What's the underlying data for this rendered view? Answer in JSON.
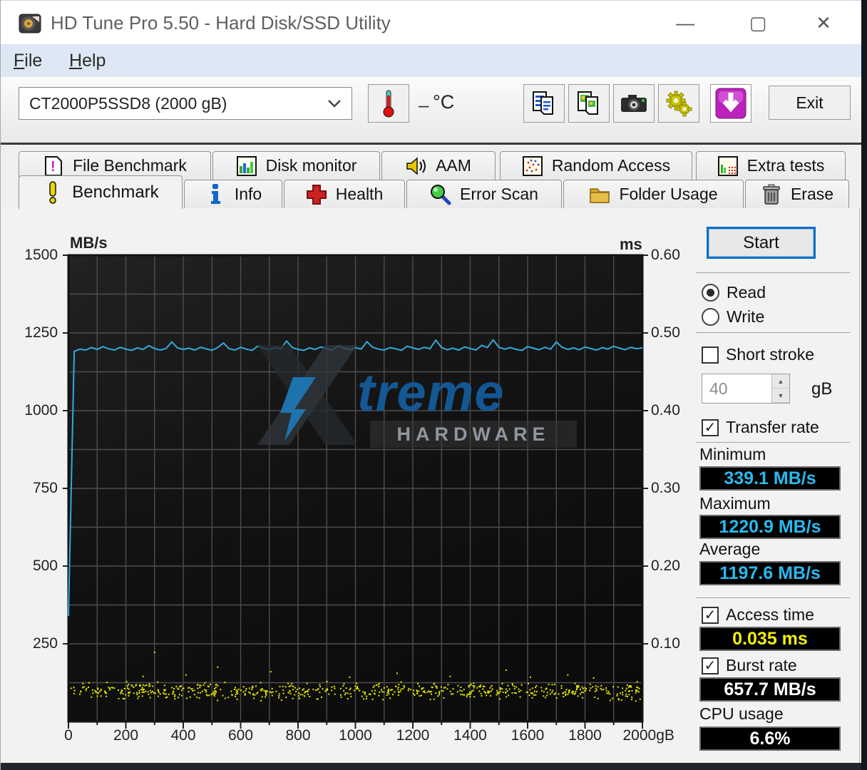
{
  "window": {
    "title": "HD Tune Pro 5.50 - Hard Disk/SSD Utility",
    "controls": {
      "minimize": "—",
      "maximize": "▢",
      "close": "✕"
    }
  },
  "menu": {
    "file": {
      "initial": "F",
      "rest": "ile"
    },
    "help": {
      "initial": "H",
      "rest": "elp"
    }
  },
  "toolbar": {
    "drive_select_value": "CT2000P5SSD8 (2000 gB)",
    "temperature_dash": "–",
    "temperature_unit": "°C",
    "exit_label": "Exit"
  },
  "tabs": {
    "row1": [
      {
        "label": "File Benchmark"
      },
      {
        "label": "Disk monitor"
      },
      {
        "label": "AAM"
      },
      {
        "label": "Random Access"
      },
      {
        "label": "Extra tests"
      }
    ],
    "row2": [
      {
        "label": "Benchmark",
        "active": true
      },
      {
        "label": "Info"
      },
      {
        "label": "Health"
      },
      {
        "label": "Error Scan"
      },
      {
        "label": "Folder Usage"
      },
      {
        "label": "Erase"
      }
    ]
  },
  "controls": {
    "start_label": "Start",
    "read_label": "Read",
    "write_label": "Write",
    "short_stroke_label": "Short stroke",
    "short_stroke_value": "40",
    "short_stroke_unit": "gB",
    "transfer_rate_label": "Transfer rate",
    "minimum_label": "Minimum",
    "minimum_value": "339.1 MB/s",
    "maximum_label": "Maximum",
    "maximum_value": "1220.9 MB/s",
    "average_label": "Average",
    "average_value": "1197.6 MB/s",
    "access_time_label": "Access time",
    "access_time_value": "0.035 ms",
    "burst_rate_label": "Burst rate",
    "burst_rate_value": "657.7 MB/s",
    "cpu_usage_label": "CPU usage",
    "cpu_usage_value": "6.6%",
    "check_glyph": "✓"
  },
  "colors": {
    "value_cyan": "#29b9ee",
    "value_yellow": "#f0ef0c",
    "value_white": "#ffffff"
  },
  "chart_data": {
    "type": "line",
    "title": "HD Tune Pro read benchmark",
    "x_axis": {
      "unit": "gB",
      "range": [
        0,
        2000
      ],
      "major_tick": 200,
      "minor_tick": 100,
      "tick_values": [
        0,
        200,
        400,
        600,
        800,
        1000,
        1200,
        1400,
        1600,
        1800,
        2000
      ],
      "tick_labels": [
        "0",
        "200",
        "400",
        "600",
        "800",
        "1000",
        "1200",
        "1400",
        "1600",
        "1800",
        "2000gB"
      ]
    },
    "left_axis": {
      "label": "MB/s",
      "range": [
        0,
        1500
      ],
      "tick_values": [
        1500,
        1250,
        1000,
        750,
        500,
        250
      ],
      "tick_labels": [
        "1500",
        "1250",
        "1000",
        "750",
        "500",
        "250"
      ]
    },
    "right_axis": {
      "label": "ms",
      "range": [
        0,
        0.6
      ],
      "tick_values": [
        0.6,
        0.5,
        0.4,
        0.3,
        0.2,
        0.1
      ],
      "tick_labels": [
        "0.60",
        "0.50",
        "0.40",
        "0.30",
        "0.20",
        "0.10"
      ]
    },
    "grid": {
      "vertical_step": 100,
      "horizontal_step": 125,
      "color": "#4e4e4e",
      "on": true
    },
    "legend": {
      "visible": false
    },
    "series": [
      {
        "name": "transfer-rate",
        "type": "line",
        "color": "#32aadc",
        "unit": "MB/s",
        "x_step": 20,
        "values": [
          339,
          1191,
          1198,
          1195,
          1203,
          1197,
          1206,
          1199,
          1195,
          1204,
          1198,
          1194,
          1202,
          1197,
          1209,
          1200,
          1195,
          1200,
          1221,
          1202,
          1197,
          1201,
          1195,
          1204,
          1199,
          1194,
          1203,
          1218,
          1199,
          1195,
          1204,
          1198,
          1194,
          1208,
          1201,
          1196,
          1203,
          1199,
          1224,
          1203,
          1197,
          1194,
          1202,
          1197,
          1205,
          1200,
          1195,
          1209,
          1201,
          1196,
          1203,
          1198,
          1222,
          1204,
          1198,
          1195,
          1203,
          1199,
          1194,
          1207,
          1202,
          1197,
          1204,
          1199,
          1227,
          1203,
          1196,
          1201,
          1195,
          1205,
          1200,
          1195,
          1210,
          1203,
          1228,
          1204,
          1198,
          1203,
          1197,
          1194,
          1206,
          1201,
          1196,
          1204,
          1198,
          1221,
          1204,
          1197,
          1202,
          1196,
          1205,
          1200,
          1195,
          1203,
          1198,
          1207,
          1201,
          1196,
          1204,
          1199,
          1202
        ]
      },
      {
        "name": "access-time",
        "type": "scatter",
        "color": "#e6e600",
        "unit": "ms",
        "band": {
          "x_range": [
            5,
            1995
          ],
          "y_range_ms": [
            0.026,
            0.052
          ],
          "count": 680,
          "seed": 42
        },
        "outliers_ms": [
          [
            300,
            0.089
          ],
          [
            260,
            0.058
          ],
          [
            520,
            0.07
          ],
          [
            705,
            0.064
          ],
          [
            980,
            0.057
          ],
          [
            1145,
            0.062
          ],
          [
            1330,
            0.058
          ],
          [
            1525,
            0.066
          ],
          [
            1740,
            0.06
          ],
          [
            1830,
            0.056
          ],
          [
            410,
            0.06
          ],
          [
            1610,
            0.057
          ]
        ]
      }
    ],
    "watermark": {
      "big_letter": "X",
      "text": "treme",
      "subtext": "HARDWARE"
    }
  }
}
